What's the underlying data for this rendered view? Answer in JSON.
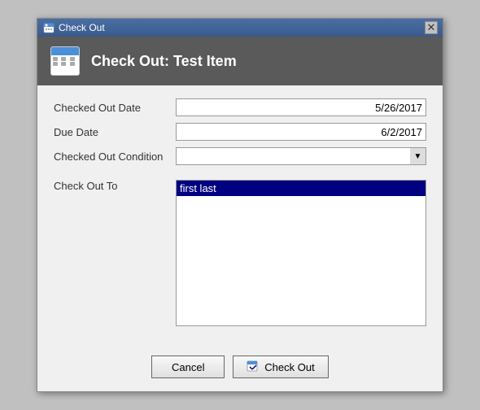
{
  "window": {
    "title": "Check Out",
    "header_title": "Check Out: Test Item"
  },
  "form": {
    "checked_out_date_label": "Checked Out Date",
    "checked_out_date_value": "5/26/2017",
    "due_date_label": "Due Date",
    "due_date_value": "6/2/2017",
    "checked_out_condition_label": "Checked Out Condition",
    "check_out_to_label": "Check Out To",
    "selected_person": "first last"
  },
  "buttons": {
    "cancel_label": "Cancel",
    "check_out_label": "Check Out"
  },
  "icons": {
    "close": "✕",
    "dropdown_arrow": "▼",
    "check_out_icon": "📋"
  }
}
